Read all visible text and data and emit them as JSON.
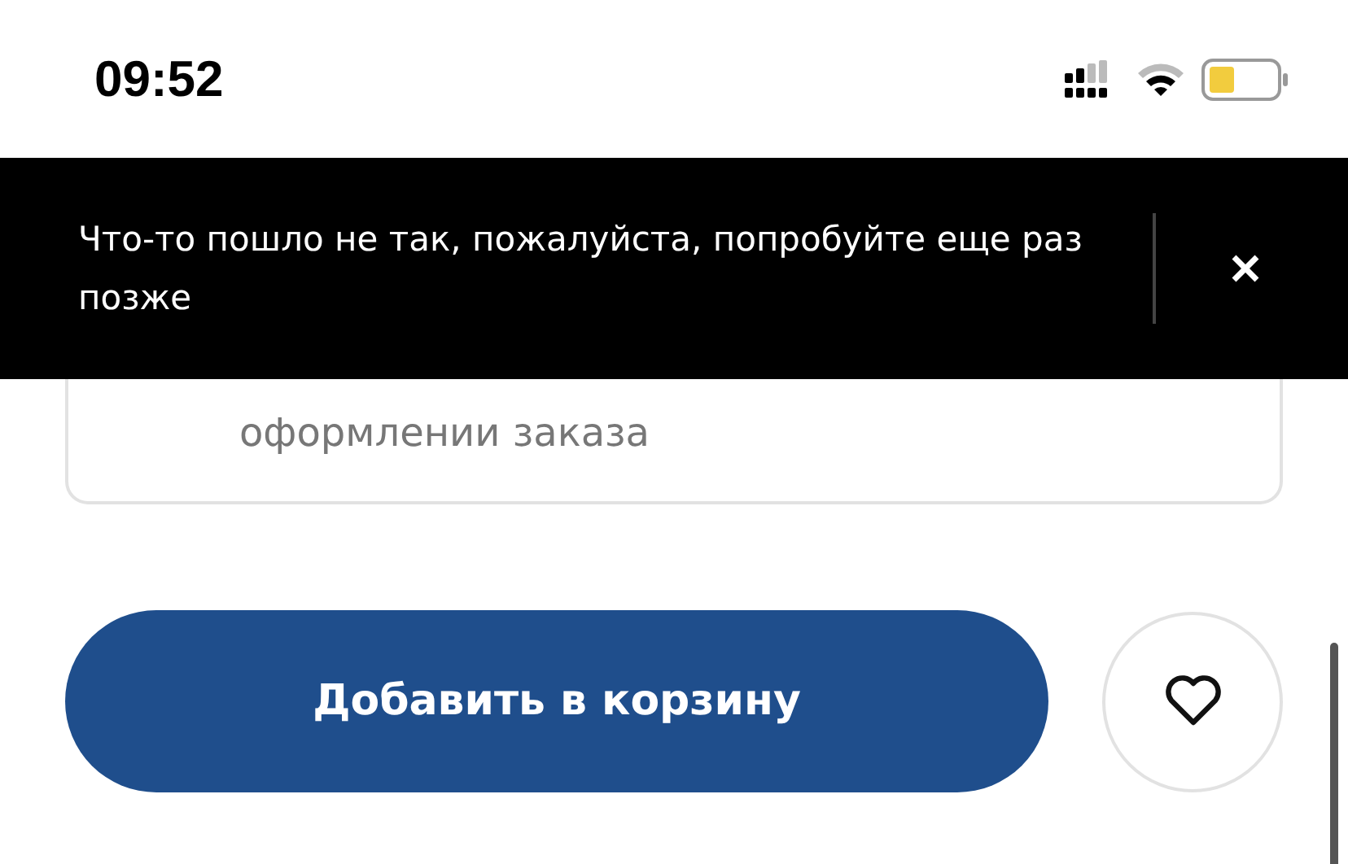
{
  "status_bar": {
    "time": "09:52"
  },
  "toast": {
    "message": "Что-то пошло не так, пожалуйста, попробуйте еще раз позже"
  },
  "info_card": {
    "text": "оформлении заказа"
  },
  "add_to_cart_button": {
    "label": "Добавить в корзину"
  }
}
